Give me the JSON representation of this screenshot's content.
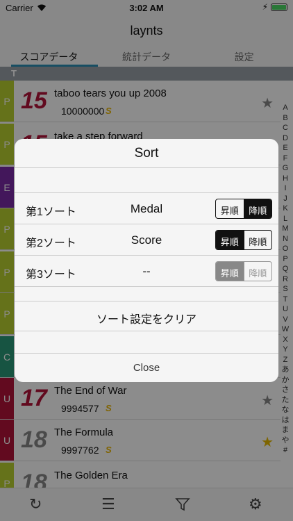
{
  "status": {
    "carrier": "Carrier",
    "time": "3:02 AM"
  },
  "nav": {
    "title": "laynts"
  },
  "tabs": [
    "スコアデータ",
    "統計データ",
    "設定"
  ],
  "section": "T",
  "rows": [
    {
      "diff": "P",
      "color": "#b9cf30",
      "level": "15",
      "level_color": "#b3133a",
      "title": "taboo tears you up 2008",
      "score": "10000000",
      "medal": "S",
      "star": "★",
      "star_color": "#888888"
    },
    {
      "diff": "P",
      "color": "#b9cf30",
      "level": "15",
      "level_color": "#b3133a",
      "title": "take a step forward",
      "score": "",
      "medal": "",
      "star": "",
      "star_color": "#888888"
    },
    {
      "diff": "E",
      "color": "#7a2aa6",
      "level": "",
      "level_color": "#888888",
      "title": "",
      "score": "",
      "medal": "",
      "star": "",
      "star_color": "#888888"
    },
    {
      "diff": "P",
      "color": "#b9cf30",
      "level": "",
      "level_color": "#888888",
      "title": "",
      "score": "",
      "medal": "",
      "star": "",
      "star_color": "#888888"
    },
    {
      "diff": "P",
      "color": "#b9cf30",
      "level": "",
      "level_color": "#888888",
      "title": "",
      "score": "",
      "medal": "",
      "star": "",
      "star_color": "#888888"
    },
    {
      "diff": "P",
      "color": "#b9cf30",
      "level": "",
      "level_color": "#888888",
      "title": "",
      "score": "",
      "medal": "",
      "star": "",
      "star_color": "#888888"
    },
    {
      "diff": "C",
      "color": "#2a9a78",
      "level": "",
      "level_color": "#888888",
      "title": "",
      "score": "",
      "medal": "",
      "star": "",
      "star_color": "#888888"
    },
    {
      "diff": "U",
      "color": "#b3133a",
      "level": "17",
      "level_color": "#b3133a",
      "title": "The End of War",
      "score": "9994577",
      "medal": "S",
      "star": "★",
      "star_color": "#888888"
    },
    {
      "diff": "U",
      "color": "#b3133a",
      "level": "18",
      "level_color": "#888888",
      "title": "The Formula",
      "score": "9997762",
      "medal": "S",
      "star": "★",
      "star_color": "#e6b800"
    },
    {
      "diff": "P",
      "color": "#b9cf30",
      "level": "18",
      "level_color": "#888888",
      "title": "The Golden Era",
      "score": "",
      "medal": "",
      "star": "",
      "star_color": "#888888"
    }
  ],
  "index": [
    "A",
    "B",
    "C",
    "D",
    "E",
    "F",
    "G",
    "H",
    "I",
    "J",
    "K",
    "L",
    "M",
    "N",
    "O",
    "P",
    "Q",
    "R",
    "S",
    "T",
    "U",
    "V",
    "W",
    "X",
    "Y",
    "Z",
    "あ",
    "か",
    "さ",
    "た",
    "な",
    "は",
    "ま",
    "や",
    "#"
  ],
  "dialog": {
    "title": "Sort",
    "sorts": [
      {
        "label": "第1ソート",
        "value": "Medal",
        "asc": "昇順",
        "desc": "降順",
        "selected": "desc",
        "enabled": true
      },
      {
        "label": "第2ソート",
        "value": "Score",
        "asc": "昇順",
        "desc": "降順",
        "selected": "asc",
        "enabled": true
      },
      {
        "label": "第3ソート",
        "value": "--",
        "asc": "昇順",
        "desc": "降順",
        "selected": "asc",
        "enabled": false
      }
    ],
    "clear_label": "ソート設定をクリア",
    "close_label": "Close"
  },
  "toolbar": {
    "icons": [
      "refresh-icon",
      "list-icon",
      "filter-icon",
      "gear-icon"
    ]
  }
}
